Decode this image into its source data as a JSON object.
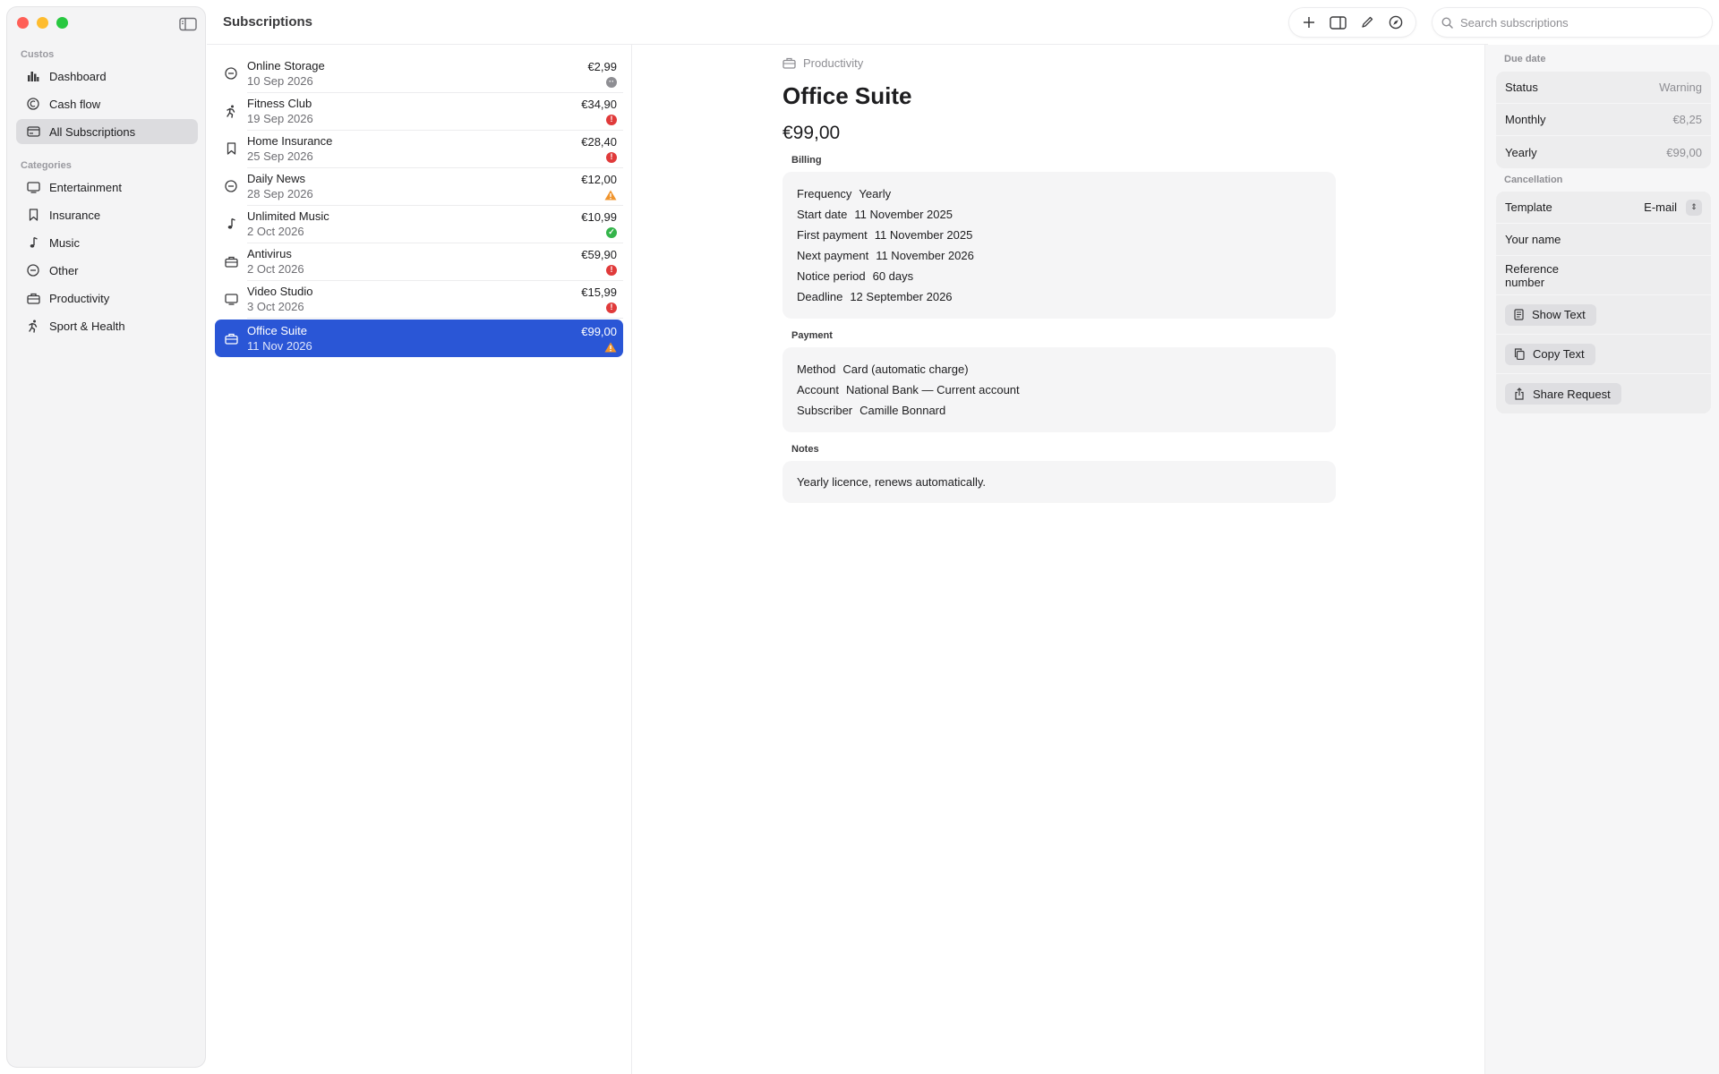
{
  "window": {
    "title": "Subscriptions"
  },
  "toolbar": {
    "add_icon": "plus-icon",
    "panel_icon": "sidebar-right-icon",
    "edit_icon": "pencil-icon",
    "explore_icon": "compass-icon"
  },
  "search": {
    "placeholder": "Search subscriptions",
    "value": ""
  },
  "sidebar": {
    "section_custos": "Custos",
    "section_categories": "Categories",
    "nav": [
      {
        "label": "Dashboard",
        "icon": "chart-icon"
      },
      {
        "label": "Cash flow",
        "icon": "currency-icon"
      },
      {
        "label": "All Subscriptions",
        "icon": "card-icon",
        "active": true
      }
    ],
    "categories": [
      {
        "label": "Entertainment",
        "icon": "tv-icon"
      },
      {
        "label": "Insurance",
        "icon": "bookmark-icon"
      },
      {
        "label": "Music",
        "icon": "music-note-icon"
      },
      {
        "label": "Other",
        "icon": "minus-circle-icon"
      },
      {
        "label": "Productivity",
        "icon": "briefcase-icon"
      },
      {
        "label": "Sport & Health",
        "icon": "runner-icon"
      }
    ]
  },
  "list": [
    {
      "name": "Online Storage",
      "date": "10 Sep 2026",
      "price": "€2,99",
      "status": "grey",
      "icon": "minus-circle-icon"
    },
    {
      "name": "Fitness Club",
      "date": "19 Sep 2026",
      "price": "€34,90",
      "status": "red",
      "icon": "runner-icon"
    },
    {
      "name": "Home Insurance",
      "date": "25 Sep 2026",
      "price": "€28,40",
      "status": "red",
      "icon": "bookmark-icon"
    },
    {
      "name": "Daily News",
      "date": "28 Sep 2026",
      "price": "€12,00",
      "status": "warning",
      "icon": "minus-circle-icon"
    },
    {
      "name": "Unlimited Music",
      "date": "2 Oct 2026",
      "price": "€10,99",
      "status": "green",
      "icon": "music-note-icon"
    },
    {
      "name": "Antivirus",
      "date": "2 Oct 2026",
      "price": "€59,90",
      "status": "red",
      "icon": "briefcase-icon"
    },
    {
      "name": "Video Studio",
      "date": "3 Oct 2026",
      "price": "€15,99",
      "status": "red",
      "icon": "tv-icon"
    },
    {
      "name": "Office Suite",
      "date": "11 Nov 2026",
      "price": "€99,00",
      "status": "warning",
      "icon": "briefcase-icon",
      "selected": true
    }
  ],
  "detail": {
    "category": "Productivity",
    "title": "Office Suite",
    "price": "€99,00",
    "billing_label": "Billing",
    "billing": [
      {
        "k": "Frequency",
        "v": "Yearly"
      },
      {
        "k": "Start date",
        "v": "11 November 2025"
      },
      {
        "k": "First payment",
        "v": "11 November 2025"
      },
      {
        "k": "Next payment",
        "v": "11 November 2026"
      },
      {
        "k": "Notice period",
        "v": "60 days"
      },
      {
        "k": "Deadline",
        "v": "12 September 2026"
      }
    ],
    "payment_label": "Payment",
    "payment": [
      {
        "k": "Method",
        "v": "Card (automatic charge)"
      },
      {
        "k": "Account",
        "v": "National Bank — Current account"
      },
      {
        "k": "Subscriber",
        "v": "Camille Bonnard"
      }
    ],
    "notes_label": "Notes",
    "notes": "Yearly licence, renews automatically."
  },
  "inspector": {
    "due_label": "Due date",
    "status_label": "Status",
    "status_value": "Warning",
    "monthly_label": "Monthly",
    "monthly_value": "€8,25",
    "yearly_label": "Yearly",
    "yearly_value": "€99,00",
    "cancellation_label": "Cancellation",
    "template_label": "Template",
    "template_value": "E-mail",
    "your_name_label": "Your name",
    "reference_label_1": "Reference",
    "reference_label_2": "number",
    "show_text": "Show Text",
    "copy_text": "Copy Text",
    "share_request": "Share Request"
  },
  "colors": {
    "accent": "#2a56d6",
    "status_red": "#e03a3a",
    "status_green": "#34b44a",
    "status_warning": "#f0942c"
  }
}
